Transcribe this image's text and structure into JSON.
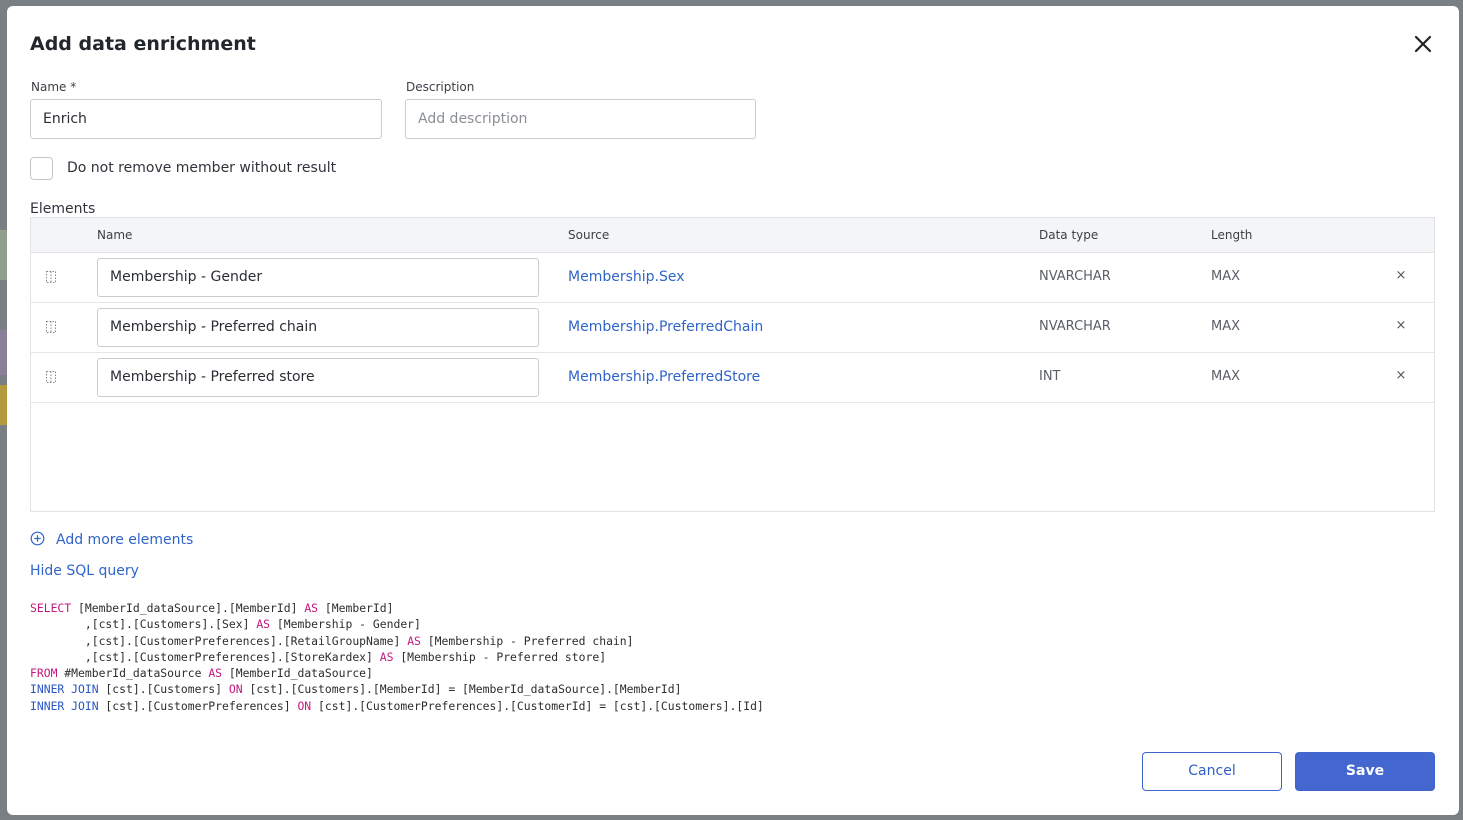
{
  "dialog": {
    "title": "Add data enrichment",
    "close_icon": "close-icon"
  },
  "form": {
    "name_label": "Name *",
    "name_value": "Enrich",
    "description_label": "Description",
    "description_placeholder": "Add description",
    "checkbox_label": "Do not remove member without result",
    "checkbox_checked": false
  },
  "elements": {
    "section_label": "Elements",
    "columns": {
      "name": "Name",
      "source": "Source",
      "data_type": "Data type",
      "length": "Length"
    },
    "rows": [
      {
        "name": "Membership - Gender",
        "source": "Membership.Sex",
        "data_type": "NVARCHAR",
        "length": "MAX",
        "remove": "×"
      },
      {
        "name": "Membership - Preferred chain",
        "source": "Membership.PreferredChain",
        "data_type": "NVARCHAR",
        "length": "MAX",
        "remove": "×"
      },
      {
        "name": "Membership - Preferred store",
        "source": "Membership.PreferredStore",
        "data_type": "INT",
        "length": "MAX",
        "remove": "×"
      }
    ],
    "add_more_label": "Add more elements"
  },
  "sql": {
    "toggle_label": "Hide SQL query",
    "lines": [
      [
        {
          "k": 1,
          "t": "SELECT"
        },
        {
          "t": " [MemberId_dataSource].[MemberId] "
        },
        {
          "k": 1,
          "t": "AS"
        },
        {
          "t": " [MemberId]"
        }
      ],
      [
        {
          "t": "        ,[cst].[Customers].[Sex] "
        },
        {
          "k": 1,
          "t": "AS"
        },
        {
          "t": " [Membership - Gender]"
        }
      ],
      [
        {
          "t": "        ,[cst].[CustomerPreferences].[RetailGroupName] "
        },
        {
          "k": 1,
          "t": "AS"
        },
        {
          "t": " [Membership - Preferred chain]"
        }
      ],
      [
        {
          "t": "        ,[cst].[CustomerPreferences].[StoreKardex] "
        },
        {
          "k": 1,
          "t": "AS"
        },
        {
          "t": " [Membership - Preferred store]"
        }
      ],
      [
        {
          "k": 1,
          "t": "FROM"
        },
        {
          "t": " #MemberId_dataSource "
        },
        {
          "k": 1,
          "t": "AS"
        },
        {
          "t": " [MemberId_dataSource]"
        }
      ],
      [
        {
          "k": 2,
          "t": "INNER JOIN"
        },
        {
          "t": " [cst].[Customers] "
        },
        {
          "k": 1,
          "t": "ON"
        },
        {
          "t": " [cst].[Customers].[MemberId] = [MemberId_dataSource].[MemberId]"
        }
      ],
      [
        {
          "k": 2,
          "t": "INNER JOIN"
        },
        {
          "t": " [cst].[CustomerPreferences] "
        },
        {
          "k": 1,
          "t": "ON"
        },
        {
          "t": " [cst].[CustomerPreferences].[CustomerId] = [cst].[Customers].[Id]"
        }
      ]
    ]
  },
  "footer": {
    "cancel_label": "Cancel",
    "save_label": "Save"
  },
  "colors": {
    "accent": "#4466cf",
    "link": "#2f64c9",
    "sql_keyword": "#c2187f",
    "sql_join": "#2a55c4"
  }
}
